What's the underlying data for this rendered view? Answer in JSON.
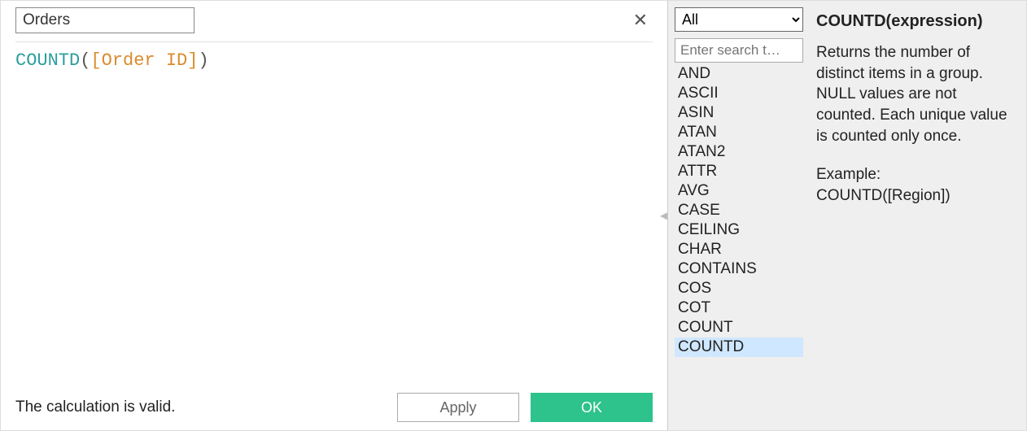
{
  "titleInput": {
    "value": "Orders"
  },
  "closeGlyph": "✕",
  "formula": {
    "funcName": "COUNTD",
    "open": "(",
    "fieldRef": "[Order ID]",
    "close": ")"
  },
  "status": "The calculation is valid.",
  "buttons": {
    "apply": "Apply",
    "ok": "OK"
  },
  "categorySelect": {
    "selected": "All"
  },
  "search": {
    "placeholder": "Enter search t…"
  },
  "functionList": [
    "AND",
    "ASCII",
    "ASIN",
    "ATAN",
    "ATAN2",
    "ATTR",
    "AVG",
    "CASE",
    "CEILING",
    "CHAR",
    "CONTAINS",
    "COS",
    "COT",
    "COUNT",
    "COUNTD"
  ],
  "selectedFunction": "COUNTD",
  "doc": {
    "heading": "COUNTD(expression)",
    "body": "Returns the number of distinct items in a group. NULL values are not counted.  Each unique value is counted only once.",
    "exampleLabel": "Example:",
    "example": "COUNTD([Region])"
  },
  "collapseGlyph": "◂"
}
